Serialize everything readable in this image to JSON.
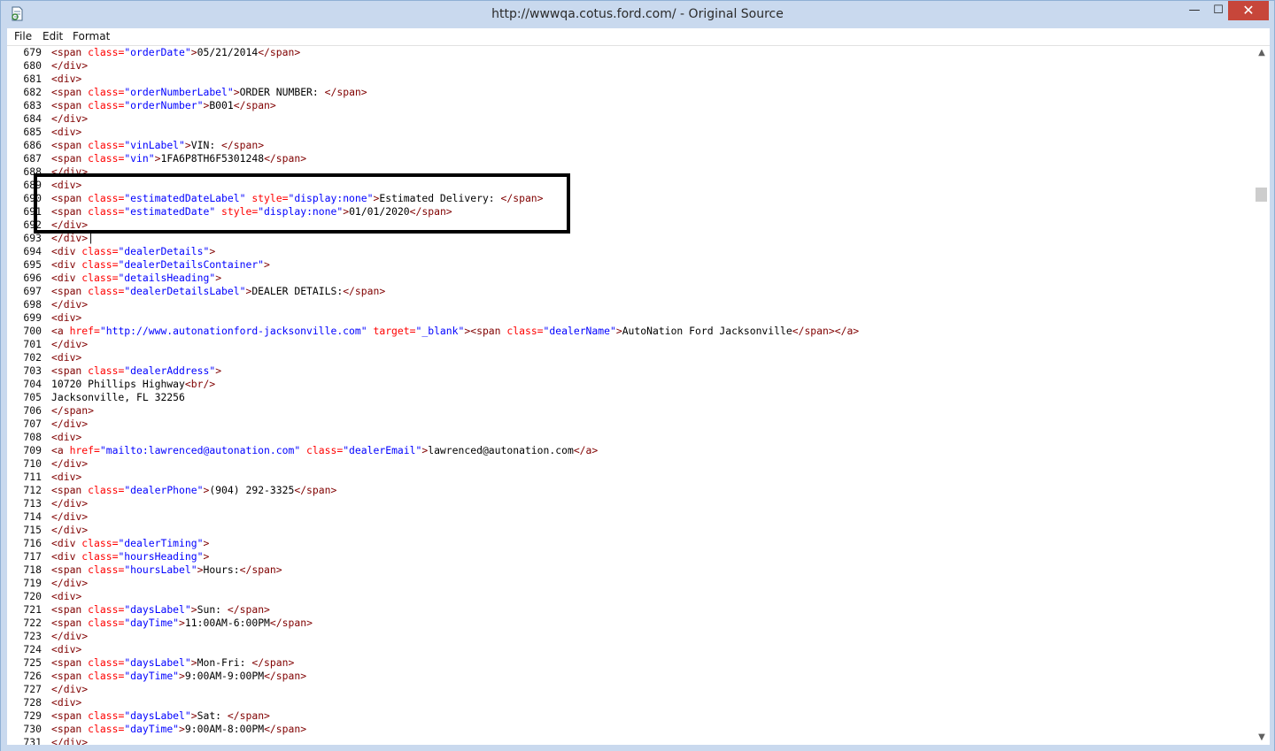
{
  "window": {
    "title": "http://wwwqa.cotus.ford.com/ - Original Source",
    "minimize_icon": "minimize-icon",
    "maximize_icon": "maximize-icon",
    "close_icon": "close-icon",
    "minimize_glyph": "—",
    "maximize_glyph": "☐",
    "close_glyph": "✕"
  },
  "menu": {
    "file": "File",
    "edit": "Edit",
    "format": "Format"
  },
  "highlight": {
    "first_line": 689,
    "last_line": 692
  },
  "scrollbar": {
    "up_glyph": "▲",
    "down_glyph": "▼"
  },
  "lines": [
    {
      "n": "679",
      "html": "<span class=\"tag\">&lt;span</span> <span class=\"attr\">class=</span><span class=\"val\">\"orderDate\"</span><span class=\"tag\">&gt;</span>05/21/2014<span class=\"tag\">&lt;/span&gt;</span>"
    },
    {
      "n": "680",
      "html": "<span class=\"tag\">&lt;/div&gt;</span>"
    },
    {
      "n": "681",
      "html": "<span class=\"tag\">&lt;div&gt;</span>"
    },
    {
      "n": "682",
      "html": "<span class=\"tag\">&lt;span</span> <span class=\"attr\">class=</span><span class=\"val\">\"orderNumberLabel\"</span><span class=\"tag\">&gt;</span>ORDER NUMBER: <span class=\"tag\">&lt;/span&gt;</span>"
    },
    {
      "n": "683",
      "html": "<span class=\"tag\">&lt;span</span> <span class=\"attr\">class=</span><span class=\"val\">\"orderNumber\"</span><span class=\"tag\">&gt;</span>B001<span class=\"tag\">&lt;/span&gt;</span>"
    },
    {
      "n": "684",
      "html": "<span class=\"tag\">&lt;/div&gt;</span>"
    },
    {
      "n": "685",
      "html": "<span class=\"tag\">&lt;div&gt;</span>"
    },
    {
      "n": "686",
      "html": "<span class=\"tag\">&lt;span</span> <span class=\"attr\">class=</span><span class=\"val\">\"vinLabel\"</span><span class=\"tag\">&gt;</span>VIN: <span class=\"tag\">&lt;/span&gt;</span>"
    },
    {
      "n": "687",
      "html": "<span class=\"tag\">&lt;span</span> <span class=\"attr\">class=</span><span class=\"val\">\"vin\"</span><span class=\"tag\">&gt;</span>1FA6P8TH6F5301248<span class=\"tag\">&lt;/span&gt;</span>"
    },
    {
      "n": "688",
      "html": "<span class=\"tag\">&lt;/div&gt;</span>"
    },
    {
      "n": "689",
      "html": "<span class=\"tag\">&lt;div&gt;</span>"
    },
    {
      "n": "690",
      "html": "<span class=\"tag\">&lt;span</span> <span class=\"attr\">class=</span><span class=\"val\">\"estimatedDateLabel\"</span> <span class=\"attr\">style=</span><span class=\"val\">\"display:none\"</span><span class=\"tag\">&gt;</span>Estimated Delivery: <span class=\"tag\">&lt;/span&gt;</span>"
    },
    {
      "n": "691",
      "html": "<span class=\"tag\">&lt;span</span> <span class=\"attr\">class=</span><span class=\"val\">\"estimatedDate\"</span> <span class=\"attr\">style=</span><span class=\"val\">\"display:none\"</span><span class=\"tag\">&gt;</span>01/01/2020<span class=\"tag\">&lt;/span&gt;</span>"
    },
    {
      "n": "692",
      "html": "<span class=\"tag\">&lt;/div&gt;</span>"
    },
    {
      "n": "693",
      "html": "<span class=\"tag\">&lt;/div&gt;</span>|"
    },
    {
      "n": "694",
      "html": "<span class=\"tag\">&lt;div</span> <span class=\"attr\">class=</span><span class=\"val\">\"dealerDetails\"</span><span class=\"tag\">&gt;</span>"
    },
    {
      "n": "695",
      "html": "<span class=\"tag\">&lt;div</span> <span class=\"attr\">class=</span><span class=\"val\">\"dealerDetailsContainer\"</span><span class=\"tag\">&gt;</span>"
    },
    {
      "n": "696",
      "html": "<span class=\"tag\">&lt;div</span> <span class=\"attr\">class=</span><span class=\"val\">\"detailsHeading\"</span><span class=\"tag\">&gt;</span>"
    },
    {
      "n": "697",
      "html": "<span class=\"tag\">&lt;span</span> <span class=\"attr\">class=</span><span class=\"val\">\"dealerDetailsLabel\"</span><span class=\"tag\">&gt;</span>DEALER DETAILS:<span class=\"tag\">&lt;/span&gt;</span>"
    },
    {
      "n": "698",
      "html": "<span class=\"tag\">&lt;/div&gt;</span>"
    },
    {
      "n": "699",
      "html": "<span class=\"tag\">&lt;div&gt;</span>"
    },
    {
      "n": "700",
      "html": "<span class=\"tag\">&lt;a</span> <span class=\"attr\">href=</span><span class=\"val\">\"http://www.autonationford-jacksonville.com\"</span> <span class=\"attr\">target=</span><span class=\"val\">\"_blank\"</span><span class=\"tag\">&gt;&lt;span</span> <span class=\"attr\">class=</span><span class=\"val\">\"dealerName\"</span><span class=\"tag\">&gt;</span>AutoNation Ford Jacksonville<span class=\"tag\">&lt;/span&gt;&lt;/a&gt;</span>"
    },
    {
      "n": "701",
      "html": "<span class=\"tag\">&lt;/div&gt;</span>"
    },
    {
      "n": "702",
      "html": "<span class=\"tag\">&lt;div&gt;</span>"
    },
    {
      "n": "703",
      "html": "<span class=\"tag\">&lt;span</span> <span class=\"attr\">class=</span><span class=\"val\">\"dealerAddress\"</span><span class=\"tag\">&gt;</span>"
    },
    {
      "n": "704",
      "html": "10720 Phillips Highway<span class=\"tag\">&lt;br/&gt;</span>"
    },
    {
      "n": "705",
      "html": "Jacksonville, FL 32256"
    },
    {
      "n": "706",
      "html": "<span class=\"tag\">&lt;/span&gt;</span>"
    },
    {
      "n": "707",
      "html": "<span class=\"tag\">&lt;/div&gt;</span>"
    },
    {
      "n": "708",
      "html": "<span class=\"tag\">&lt;div&gt;</span>"
    },
    {
      "n": "709",
      "html": "<span class=\"tag\">&lt;a</span> <span class=\"attr\">href=</span><span class=\"val\">\"mailto:lawrenced@autonation.com\"</span> <span class=\"attr\">class=</span><span class=\"val\">\"dealerEmail\"</span><span class=\"tag\">&gt;</span>lawrenced@autonation.com<span class=\"tag\">&lt;/a&gt;</span>"
    },
    {
      "n": "710",
      "html": "<span class=\"tag\">&lt;/div&gt;</span>"
    },
    {
      "n": "711",
      "html": "<span class=\"tag\">&lt;div&gt;</span>"
    },
    {
      "n": "712",
      "html": "<span class=\"tag\">&lt;span</span> <span class=\"attr\">class=</span><span class=\"val\">\"dealerPhone\"</span><span class=\"tag\">&gt;</span>(904) 292-3325<span class=\"tag\">&lt;/span&gt;</span>"
    },
    {
      "n": "713",
      "html": "<span class=\"tag\">&lt;/div&gt;</span>"
    },
    {
      "n": "714",
      "html": "<span class=\"tag\">&lt;/div&gt;</span>"
    },
    {
      "n": "715",
      "html": "<span class=\"tag\">&lt;/div&gt;</span>"
    },
    {
      "n": "716",
      "html": "<span class=\"tag\">&lt;div</span> <span class=\"attr\">class=</span><span class=\"val\">\"dealerTiming\"</span><span class=\"tag\">&gt;</span>"
    },
    {
      "n": "717",
      "html": "<span class=\"tag\">&lt;div</span> <span class=\"attr\">class=</span><span class=\"val\">\"hoursHeading\"</span><span class=\"tag\">&gt;</span>"
    },
    {
      "n": "718",
      "html": "<span class=\"tag\">&lt;span</span> <span class=\"attr\">class=</span><span class=\"val\">\"hoursLabel\"</span><span class=\"tag\">&gt;</span>Hours:<span class=\"tag\">&lt;/span&gt;</span>"
    },
    {
      "n": "719",
      "html": "<span class=\"tag\">&lt;/div&gt;</span>"
    },
    {
      "n": "720",
      "html": "<span class=\"tag\">&lt;div&gt;</span>"
    },
    {
      "n": "721",
      "html": "<span class=\"tag\">&lt;span</span> <span class=\"attr\">class=</span><span class=\"val\">\"daysLabel\"</span><span class=\"tag\">&gt;</span>Sun: <span class=\"tag\">&lt;/span&gt;</span>"
    },
    {
      "n": "722",
      "html": "<span class=\"tag\">&lt;span</span> <span class=\"attr\">class=</span><span class=\"val\">\"dayTime\"</span><span class=\"tag\">&gt;</span>11:00AM-6:00PM<span class=\"tag\">&lt;/span&gt;</span>"
    },
    {
      "n": "723",
      "html": "<span class=\"tag\">&lt;/div&gt;</span>"
    },
    {
      "n": "724",
      "html": "<span class=\"tag\">&lt;div&gt;</span>"
    },
    {
      "n": "725",
      "html": "<span class=\"tag\">&lt;span</span> <span class=\"attr\">class=</span><span class=\"val\">\"daysLabel\"</span><span class=\"tag\">&gt;</span>Mon-Fri: <span class=\"tag\">&lt;/span&gt;</span>"
    },
    {
      "n": "726",
      "html": "<span class=\"tag\">&lt;span</span> <span class=\"attr\">class=</span><span class=\"val\">\"dayTime\"</span><span class=\"tag\">&gt;</span>9:00AM-9:00PM<span class=\"tag\">&lt;/span&gt;</span>"
    },
    {
      "n": "727",
      "html": "<span class=\"tag\">&lt;/div&gt;</span>"
    },
    {
      "n": "728",
      "html": "<span class=\"tag\">&lt;div&gt;</span>"
    },
    {
      "n": "729",
      "html": "<span class=\"tag\">&lt;span</span> <span class=\"attr\">class=</span><span class=\"val\">\"daysLabel\"</span><span class=\"tag\">&gt;</span>Sat: <span class=\"tag\">&lt;/span&gt;</span>"
    },
    {
      "n": "730",
      "html": "<span class=\"tag\">&lt;span</span> <span class=\"attr\">class=</span><span class=\"val\">\"dayTime\"</span><span class=\"tag\">&gt;</span>9:00AM-8:00PM<span class=\"tag\">&lt;/span&gt;</span>"
    },
    {
      "n": "731",
      "html": "<span class=\"tag\">&lt;/div&gt;</span>"
    }
  ]
}
